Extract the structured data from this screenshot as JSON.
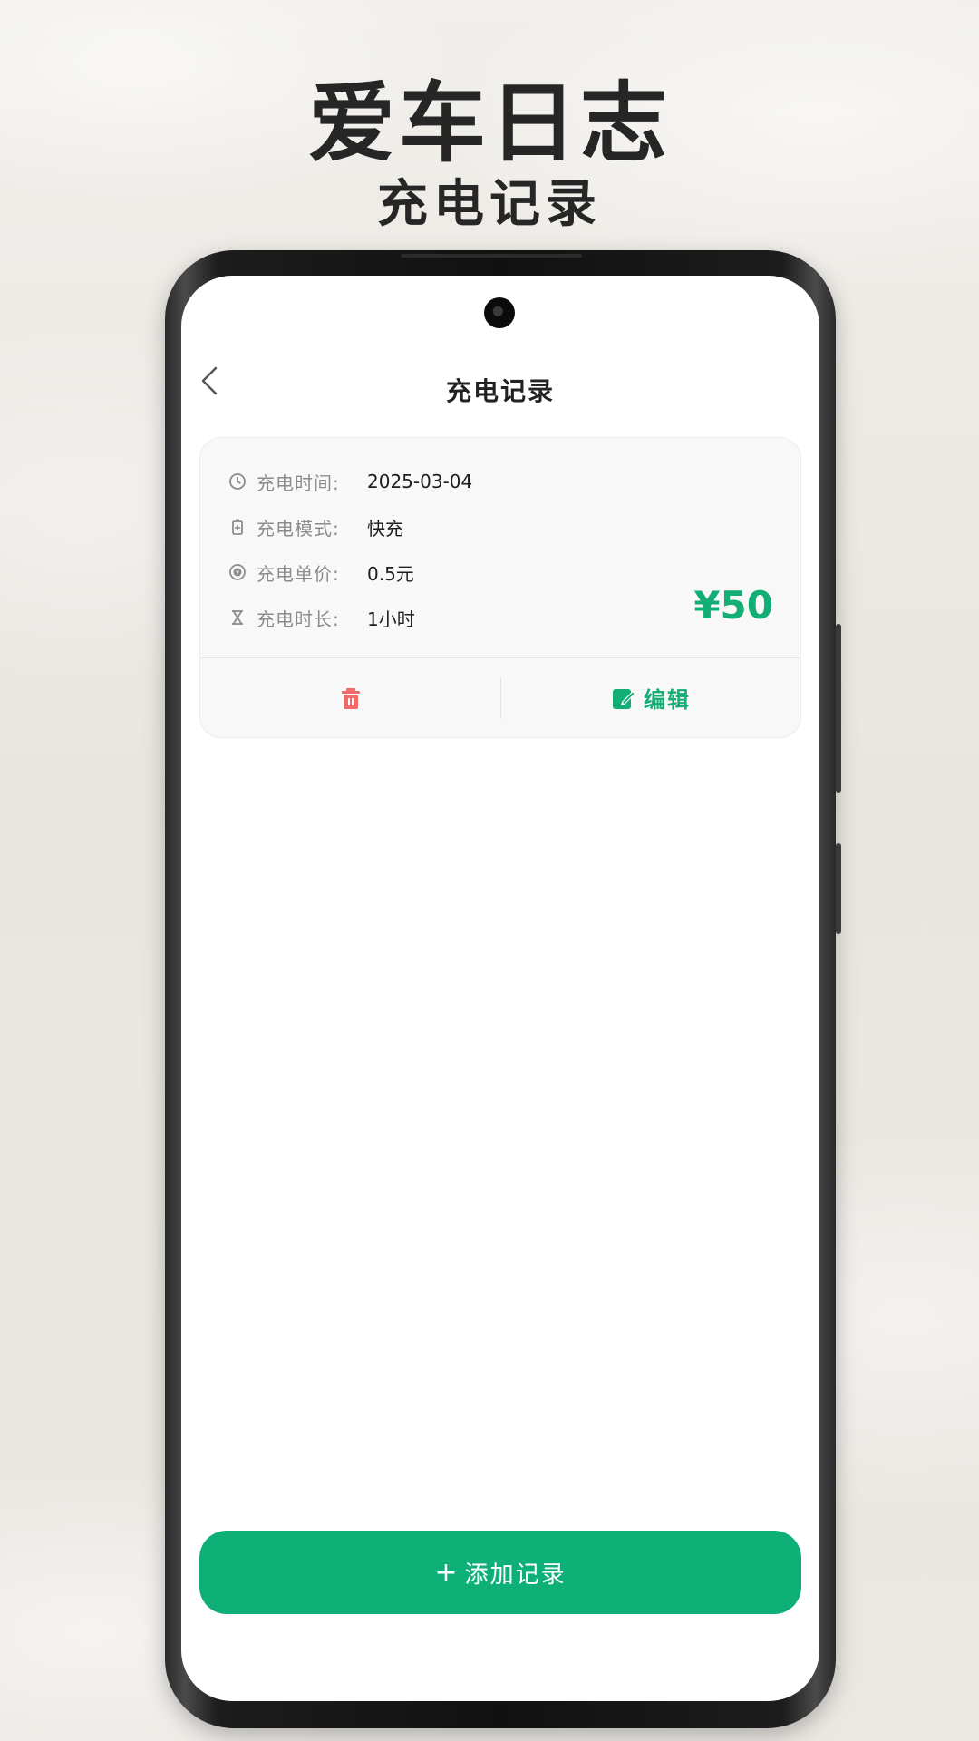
{
  "promo": {
    "title": "爱车日志",
    "subtitle": "充电记录"
  },
  "header": {
    "title": "充电记录",
    "back_icon": "chevron-left-icon"
  },
  "record": {
    "rows": [
      {
        "icon": "clock-icon",
        "label": "充电时间:",
        "value": "2025-03-04"
      },
      {
        "icon": "battery-icon",
        "label": "充电模式:",
        "value": "快充"
      },
      {
        "icon": "coin-icon",
        "label": "充电单价:",
        "value": "0.5元"
      },
      {
        "icon": "hourglass-icon",
        "label": "充电时长:",
        "value": "1小时"
      }
    ],
    "amount": "¥50",
    "delete_icon": "trash-icon",
    "edit_label": "编辑"
  },
  "add_button": {
    "plus": "+",
    "label": "添加记录"
  },
  "colors": {
    "accent": "#12ae75",
    "danger": "#ef6b6b",
    "background": "#ece9e4"
  }
}
